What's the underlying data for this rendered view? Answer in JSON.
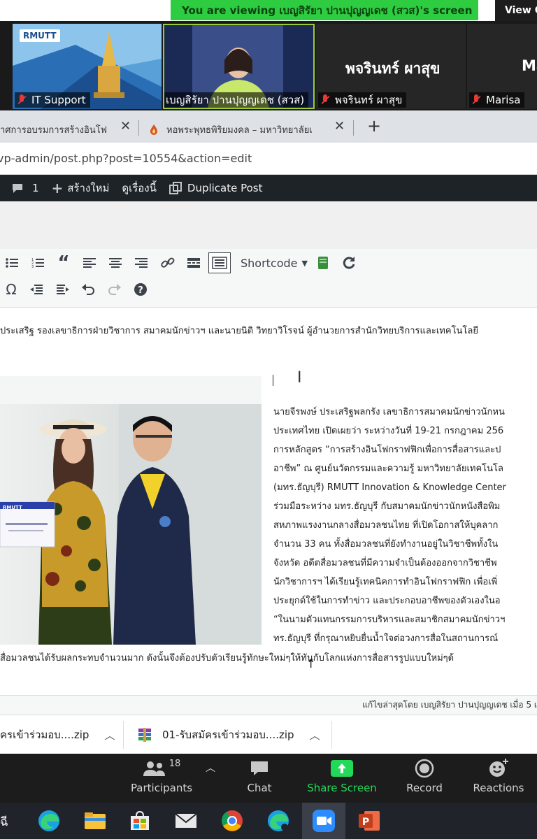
{
  "zoom_banner": {
    "viewing_text": "You are viewing เบญสิรัยา ปานปุญญเดช (สวส)'s screen",
    "view_options": "View O"
  },
  "video_tiles": [
    {
      "name": "IT Support",
      "logo_text": "RMUTT"
    },
    {
      "name": "เบญสิรัยา ปานปุญญเดช (สวส)"
    },
    {
      "name": "พจรินทร์ ผาสุข",
      "display_name": "พจรินทร์ ผาสุข"
    },
    {
      "name": "Marisa",
      "display_name": "Ma"
    }
  ],
  "browser": {
    "tabs": [
      {
        "title": "าศการอบรมการสร้างอินโฟ"
      },
      {
        "title": "หอพระพุทธพิริยมงคล – มหาวิทยาลัยเ"
      }
    ],
    "new_tab": "+",
    "url": "vp-admin/post.php?post=10554&action=edit"
  },
  "wp_admin_bar": {
    "comments_count": "1",
    "new_label": "สร้างใหม่",
    "view_label": "ดูเรื่องนี้",
    "duplicate_label": "Duplicate Post"
  },
  "editor": {
    "shortcode_label": "Shortcode",
    "intro_line": "ประเสริฐ รองเลขาธิการฝ่ายวิชาการ สมาคมนักข่าวฯ และนายนิติ วิทยาวิโรจน์ ผู้อำนวยการสำนักวิทยบริการและเทคโนโลยี",
    "certificate_logo": "RMUTT",
    "body_lines": [
      "นายจีรพงษ์ ประเสริฐพลกรัง เลขาธิการสมาคมนักข่าวนักหน",
      "ประเทศไทย เปิดเผยว่า ระหว่างวันที่ 19-21 กรกฎาคม 256",
      "การหลักสูตร “การสร้างอินโฟกราฟฟิกเพื่อการสื่อสารและป",
      "อาชีพ” ณ ศูนย์นวัตกรรมและความรู้ มหาวิทยาลัยเทคโนโล",
      "(มทร.ธัญบุรี) RMUTT Innovation & Knowledge Center",
      "ร่วมมือระหว่าง มทร.ธัญบุรี กับสมาคมนักข่าวนักหนังสือพิม",
      "สหภาพแรงงานกลางสื่อมวลชนไทย ที่เปิดโอกาสให้บุคลาก",
      "จำนวน 33 คน ทั้งสื่อมวลชนที่ยังทำงานอยู่ในวิชาชีพทั้งใน",
      "จังหวัด อดีตสื่อมวลชนที่มีความจำเป็นต้องออกจากวิชาชีพ",
      "นักวิชาการฯ ได้เรียนรู้เทคนิคการทำอินโฟกราฟฟิก เพื่อเพิ่",
      "ประยุกต์ใช้ในการทำข่าว และประกอบอาชีพของตัวเองในอ",
      "“ในนามตัวแทนกรรมการบริหารและสมาชิกสมาคมนักข่าวฯ",
      "ทร.ธัญบุรี ที่กรุณาหยิบยื่นน้ำใจต่อวงการสื่อในสถานการณ์"
    ],
    "bottom_line": "สื่อมวลชนได้รับผลกระทบจำนวนมาก ดังนั้นจึงต้องปรับตัวเรียนรู้ทักษะใหม่ๆให้ทันกับโลกแห่งการสื่อสารรูปแบบใหม่ๆด้",
    "last_edited": "แก้ไขล่าสุดโดย เบญสิรัยา ปานปุญญเดช เมื่อ 5 เ"
  },
  "downloads": [
    {
      "name": "ครเข้าร่วมอบ....zip"
    },
    {
      "name": "01-รับสมัครเข้าร่วมอบ....zip"
    }
  ],
  "zoom_controls": {
    "participants_count": "18",
    "participants": "Participants",
    "chat": "Chat",
    "share_screen": "Share Screen",
    "record": "Record",
    "reactions": "Reactions"
  },
  "taskbar": {
    "partial_label": "ฉี"
  },
  "colors": {
    "banner_green": "#2ecc40",
    "share_green": "#23d959",
    "wp_dark": "#1d2327",
    "zoom_dark": "#1c1c1c"
  }
}
